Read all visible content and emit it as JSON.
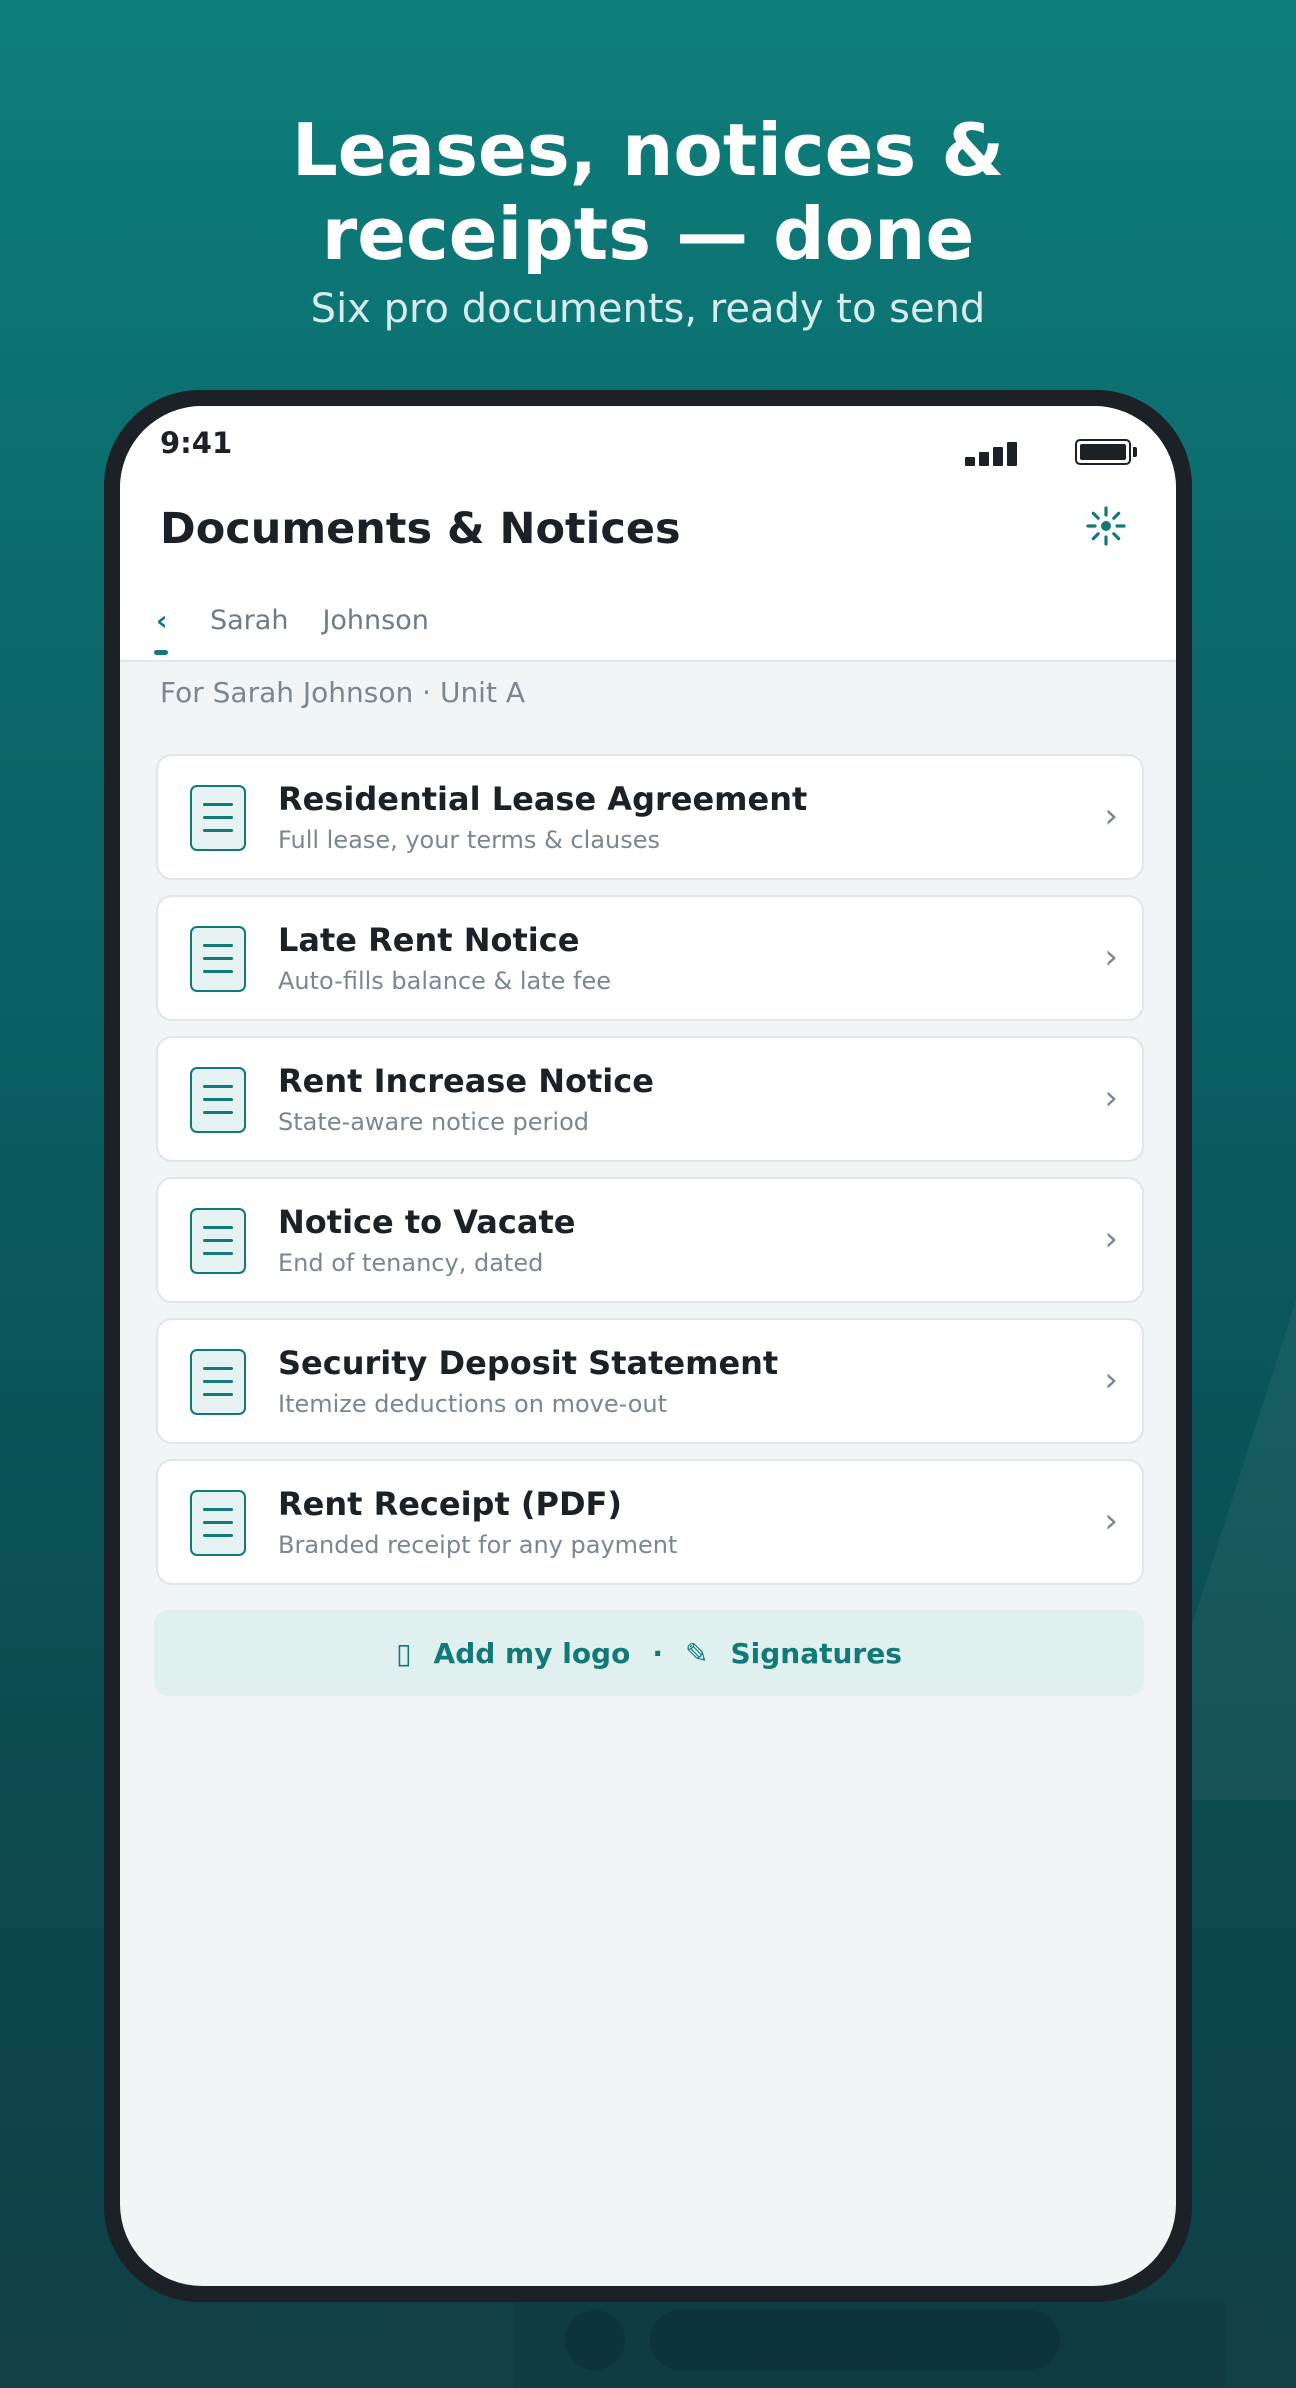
{
  "marketing": {
    "headline_line1": "Leases, notices &",
    "headline_line2": "receipts — done",
    "subhead": "Six pro documents, ready to send"
  },
  "status_bar": {
    "time": "9:41"
  },
  "header": {
    "title": "Documents & Notices",
    "settings_icon": "gear-icon"
  },
  "tabs": {
    "back_glyph": "‹",
    "items": [
      "Sarah",
      "Johnson"
    ]
  },
  "context": {
    "for_line": "For Sarah Johnson · Unit A"
  },
  "documents": [
    {
      "title": "Residential Lease Agreement",
      "subtitle": "Full lease, your terms & clauses"
    },
    {
      "title": "Late Rent Notice",
      "subtitle": "Auto-fills balance & late fee"
    },
    {
      "title": "Rent Increase Notice",
      "subtitle": "State-aware notice period"
    },
    {
      "title": "Notice to Vacate",
      "subtitle": "End of tenancy, dated"
    },
    {
      "title": "Security Deposit Statement",
      "subtitle": "Itemize deductions on move-out"
    },
    {
      "title": "Rent Receipt (PDF)",
      "subtitle": "Branded receipt for any payment"
    }
  ],
  "actions": {
    "logo_icon": "▯",
    "logo_label": "Add my logo",
    "separator": "·",
    "signature_icon": "✎",
    "signature_label": "Signatures"
  },
  "colors": {
    "accent": "#117a78",
    "background_top": "#0e7f7c",
    "background_bottom": "#103f45"
  }
}
